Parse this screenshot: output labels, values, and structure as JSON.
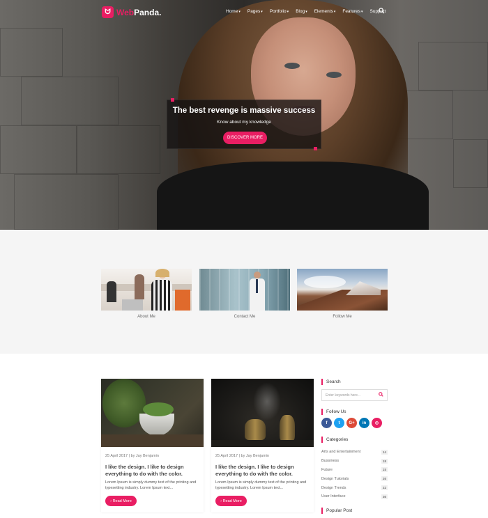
{
  "brand": {
    "name_part1": "Web",
    "name_part2": "Panda."
  },
  "nav": {
    "items": [
      {
        "label": "Home",
        "caret": "▾"
      },
      {
        "label": "Pages",
        "caret": "▾"
      },
      {
        "label": "Portfolio",
        "caret": "▾"
      },
      {
        "label": "Blog",
        "caret": "▾"
      },
      {
        "label": "Elements",
        "caret": "▾"
      },
      {
        "label": "Features",
        "caret": "▾"
      },
      {
        "label": "Support",
        "caret": ""
      }
    ],
    "search_icon": "search-icon"
  },
  "hero": {
    "title": "The best revenge is massive success",
    "subtitle": "Know about my knowledge",
    "button": "DISCOVER MORE"
  },
  "features": [
    {
      "label": "About Me"
    },
    {
      "label": "Contact Me"
    },
    {
      "label": "Follow Me"
    }
  ],
  "posts": [
    {
      "meta": "25 April 2017 | by Jay Benjamin",
      "title": "I like the design. I like to design everything to do with the color.",
      "desc": "Lorem Ipsum is simply dummy text of the printing and typesetting industry. Lorem Ipsum text...",
      "button": "Read More"
    },
    {
      "meta": "25 April 2017 | by Jay Benjamin",
      "title": "I like the design. I like to design everything to do with the color.",
      "desc": "Lorem Ipsum is simply dummy text of the printing and typesetting industry. Lorem Ipsum text...",
      "button": "Read More"
    }
  ],
  "sidebar": {
    "search_title": "Search",
    "search_placeholder": "Enter keywords here...",
    "follow_title": "Follow Us",
    "social": [
      {
        "label": "f",
        "icon": "facebook-icon",
        "color": "#3b5998"
      },
      {
        "label": "t",
        "icon": "twitter-icon",
        "color": "#1da1f2"
      },
      {
        "label": "G+",
        "icon": "google-plus-icon",
        "color": "#dd4b39"
      },
      {
        "label": "in",
        "icon": "linkedin-icon",
        "color": "#0077b5"
      },
      {
        "label": "◎",
        "icon": "instagram-icon",
        "color": "#e91e63"
      }
    ],
    "categories_title": "Categories",
    "categories": [
      {
        "name": "Arts and Entertainment",
        "count": "14"
      },
      {
        "name": "Bussiness",
        "count": "18"
      },
      {
        "name": "Future",
        "count": "15"
      },
      {
        "name": "Design Tutorials",
        "count": "26"
      },
      {
        "name": "Design Trends",
        "count": "22"
      },
      {
        "name": "User Interface",
        "count": "36"
      }
    ],
    "popular_title": "Popular Post"
  },
  "colors": {
    "accent": "#e91e63"
  }
}
